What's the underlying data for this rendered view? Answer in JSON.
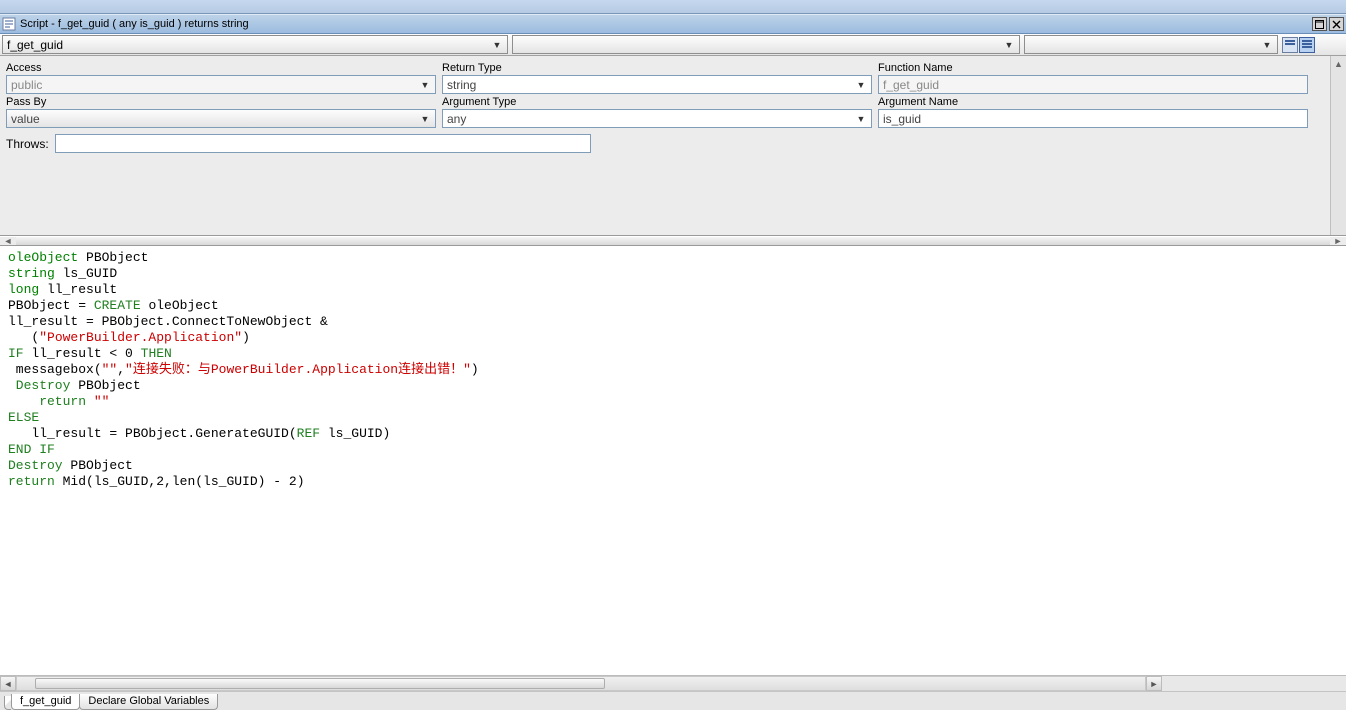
{
  "titlebar": {
    "text": "Script - f_get_guid ( any is_guid )  returns string"
  },
  "combos": {
    "c1": "f_get_guid",
    "c2": "",
    "c3": ""
  },
  "labels": {
    "access": "Access",
    "returnType": "Return Type",
    "functionName": "Function Name",
    "passBy": "Pass By",
    "argType": "Argument Type",
    "argName": "Argument Name",
    "throws": "Throws:"
  },
  "fields": {
    "access": "public",
    "returnType": "string",
    "functionName": "f_get_guid",
    "passBy": "value",
    "argType": "any",
    "argName": "is_guid",
    "throws": ""
  },
  "tabs": {
    "t1": "f_get_guid",
    "t2": "Declare Global Variables"
  },
  "code": {
    "l1a": "oleObject",
    "l1b": " PBObject",
    "l2a": "string",
    "l2b": " ls_GUID",
    "l3a": "long",
    "l3b": " ll_result",
    "l4a": "PBObject = ",
    "l4b": "CREATE",
    "l4c": " oleObject",
    "l5": "ll_result = PBObject.ConnectToNewObject &",
    "l6a": "   (",
    "l6b": "\"PowerBuilder.Application\"",
    "l6c": ")",
    "l7a": "IF",
    "l7b": " ll_result < ",
    "l7c": "0",
    "l7d": " THEN",
    "l8a": " messagebox(",
    "l8b": "\"\"",
    "l8c": ",",
    "l8d": "\"连接失败：与PowerBuilder.Application连接出错！\"",
    "l8e": ")",
    "l9a": " Destroy",
    "l9b": " PBObject",
    "l10a": "    return ",
    "l10b": "\"\"",
    "l11": "ELSE",
    "l12a": "   ll_result = PBObject.GenerateGUID(",
    "l12b": "REF",
    "l12c": " ls_GUID)",
    "l13": "END IF",
    "l14a": "Destroy",
    "l14b": " PBObject",
    "l15a": "return",
    "l15b": " Mid(ls_GUID,",
    "l15c": "2",
    "l15d": ",len(ls_GUID) - ",
    "l15e": "2",
    "l15f": ")"
  }
}
